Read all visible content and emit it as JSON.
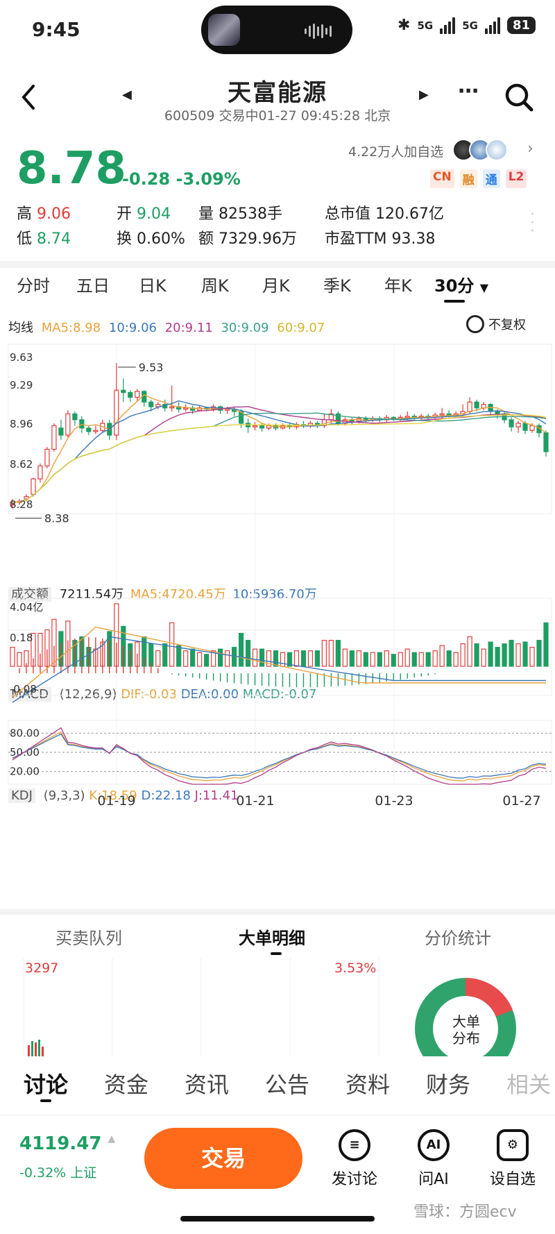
{
  "status": {
    "time": "9:45",
    "net1": "5G",
    "net2": "5G",
    "battery": "81"
  },
  "header": {
    "title": "天富能源",
    "subtitle": "600509 交易中01-27 09:45:28 北京"
  },
  "quote": {
    "price": "8.78",
    "change": "-0.28",
    "change_pct": "-3.09%",
    "watchers": "4.22万人加自选",
    "badges": [
      "CN",
      "融",
      "通",
      "L2"
    ],
    "stats": [
      {
        "label": "高",
        "value": "9.06",
        "color": "#e03b3b"
      },
      {
        "label": "开",
        "value": "9.04",
        "color": "#1e9e63"
      },
      {
        "label": "量",
        "value": "82538手",
        "color": "#222"
      },
      {
        "label": "总市值",
        "value": "120.67亿",
        "color": "#222"
      },
      {
        "label": "低",
        "value": "8.74",
        "color": "#1e9e63"
      },
      {
        "label": "换",
        "value": "0.60%",
        "color": "#222"
      },
      {
        "label": "额",
        "value": "7329.96万",
        "color": "#222"
      },
      {
        "label": "市盈TTM",
        "value": "93.38",
        "color": "#222"
      }
    ]
  },
  "period_tabs": [
    "分时",
    "五日",
    "日K",
    "周K",
    "月K",
    "季K",
    "年K",
    "30分"
  ],
  "active_period": "30分",
  "ma_legend": {
    "label": "均线",
    "ma5": "MA5:8.98",
    "ma10": "10:9.06",
    "ma20": "20:9.11",
    "ma30": "30:9.09",
    "ma60": "60:9.07",
    "adjust": "不复权"
  },
  "volume_legend": {
    "label": "成交额",
    "value": "7211.54万",
    "ma5": "MA5:4720.45万",
    "ma10": "10:5936.70万"
  },
  "macd_legend": {
    "label": "MACD",
    "params": "(12,26,9)",
    "dif": "DIF:-0.03",
    "dea": "DEA:0.00",
    "macd": "MACD:-0.07"
  },
  "kdj_legend": {
    "label": "KDJ",
    "params": "(9,3,3)",
    "k": "K:18.59",
    "d": "D:22.18",
    "j": "J:11.41"
  },
  "chart_data": {
    "type": "candlestick",
    "interval": "30分",
    "price_axis_ticks": [
      "9.63",
      "9.29",
      "8.96",
      "8.62",
      "8.28"
    ],
    "high_label": "9.53",
    "low_label": "8.38",
    "volume_axis_ticks": [
      "4.04亿"
    ],
    "macd_axis_ticks": [
      "0.18",
      "-0.08"
    ],
    "kdj_axis_ticks": [
      "80.00",
      "50.00",
      "20.00"
    ],
    "date_labels": [
      "01-19",
      "01-21",
      "01-23",
      "01-27"
    ],
    "ylim": [
      8.28,
      9.63
    ],
    "candles": [
      [
        8.33,
        8.35,
        8.3,
        8.38
      ],
      [
        8.35,
        8.36,
        8.33,
        8.38
      ],
      [
        8.38,
        8.4,
        8.36,
        8.42
      ],
      [
        8.42,
        8.55,
        8.4,
        8.56
      ],
      [
        8.55,
        8.66,
        8.52,
        8.68
      ],
      [
        8.66,
        8.8,
        8.64,
        8.82
      ],
      [
        8.8,
        9.0,
        8.78,
        9.02
      ],
      [
        8.98,
        8.92,
        8.88,
        9.05
      ],
      [
        8.92,
        9.1,
        8.9,
        9.13
      ],
      [
        9.1,
        9.05,
        9.0,
        9.12
      ],
      [
        9.05,
        8.98,
        8.94,
        9.08
      ],
      [
        8.98,
        8.95,
        8.92,
        9.0
      ],
      [
        8.95,
        8.96,
        8.93,
        9.0
      ],
      [
        8.96,
        9.02,
        8.94,
        9.05
      ],
      [
        9.02,
        8.92,
        8.88,
        9.05
      ],
      [
        8.92,
        9.3,
        8.88,
        9.53
      ],
      [
        9.3,
        9.28,
        9.2,
        9.4
      ],
      [
        9.28,
        9.24,
        9.2,
        9.3
      ],
      [
        9.24,
        9.29,
        9.2,
        9.31
      ],
      [
        9.29,
        9.2,
        9.16,
        9.3
      ],
      [
        9.2,
        9.16,
        9.12,
        9.22
      ],
      [
        9.16,
        9.18,
        9.14,
        9.2
      ],
      [
        9.18,
        9.15,
        9.12,
        9.22
      ],
      [
        9.15,
        9.16,
        9.12,
        9.34
      ],
      [
        9.16,
        9.14,
        9.11,
        9.2
      ],
      [
        9.14,
        9.15,
        9.12,
        9.18
      ],
      [
        9.15,
        9.13,
        9.1,
        9.17
      ],
      [
        9.13,
        9.15,
        9.12,
        9.17
      ],
      [
        9.15,
        9.14,
        9.12,
        9.16
      ],
      [
        9.14,
        9.16,
        9.12,
        9.18
      ],
      [
        9.16,
        9.13,
        9.1,
        9.17
      ],
      [
        9.13,
        9.14,
        9.1,
        9.16
      ],
      [
        9.14,
        9.12,
        9.08,
        9.16
      ],
      [
        9.12,
        9.02,
        8.98,
        9.14
      ],
      [
        9.02,
        8.99,
        8.94,
        9.06
      ],
      [
        8.99,
        9.0,
        8.96,
        9.03
      ],
      [
        9.0,
        8.98,
        8.95,
        9.02
      ],
      [
        8.98,
        9.0,
        8.96,
        9.02
      ],
      [
        9.0,
        8.98,
        8.96,
        9.02
      ],
      [
        8.98,
        9.0,
        8.97,
        9.02
      ],
      [
        9.0,
        8.99,
        8.97,
        9.02
      ],
      [
        8.99,
        9.01,
        8.97,
        9.03
      ],
      [
        9.01,
        9.0,
        8.98,
        9.04
      ],
      [
        9.0,
        9.02,
        8.98,
        9.04
      ],
      [
        9.02,
        9.0,
        8.98,
        9.04
      ],
      [
        9.0,
        9.05,
        8.98,
        9.1
      ],
      [
        9.05,
        9.1,
        9.02,
        9.14
      ],
      [
        9.1,
        9.02,
        9.0,
        9.12
      ],
      [
        9.02,
        9.05,
        9.0,
        9.07
      ],
      [
        9.05,
        9.04,
        9.01,
        9.07
      ],
      [
        9.04,
        9.06,
        9.02,
        9.08
      ],
      [
        9.06,
        9.05,
        9.03,
        9.08
      ],
      [
        9.05,
        9.06,
        9.03,
        9.08
      ],
      [
        9.06,
        9.05,
        9.03,
        9.08
      ],
      [
        9.05,
        9.07,
        9.03,
        9.09
      ],
      [
        9.07,
        9.06,
        9.04,
        9.08
      ],
      [
        9.06,
        9.07,
        9.04,
        9.09
      ],
      [
        9.07,
        9.08,
        9.05,
        9.12
      ],
      [
        9.08,
        9.07,
        9.05,
        9.1
      ],
      [
        9.07,
        9.08,
        9.05,
        9.1
      ],
      [
        9.08,
        9.07,
        9.05,
        9.1
      ],
      [
        9.07,
        9.09,
        9.05,
        9.11
      ],
      [
        9.09,
        9.1,
        9.06,
        9.15
      ],
      [
        9.1,
        9.09,
        9.07,
        9.13
      ],
      [
        9.09,
        9.1,
        9.07,
        9.12
      ],
      [
        9.1,
        9.12,
        9.08,
        9.18
      ],
      [
        9.12,
        9.2,
        9.1,
        9.24
      ],
      [
        9.2,
        9.15,
        9.12,
        9.22
      ],
      [
        9.15,
        9.18,
        9.13,
        9.2
      ],
      [
        9.18,
        9.12,
        9.08,
        9.19
      ],
      [
        9.12,
        9.1,
        9.06,
        9.14
      ],
      [
        9.1,
        9.05,
        9.02,
        9.12
      ],
      [
        9.05,
        8.99,
        8.95,
        9.07
      ],
      [
        8.99,
        9.02,
        8.94,
        9.04
      ],
      [
        9.02,
        8.96,
        8.93,
        9.04
      ],
      [
        8.96,
        9.0,
        8.94,
        9.02
      ],
      [
        9.0,
        8.94,
        8.9,
        9.02
      ],
      [
        8.94,
        8.78,
        8.74,
        8.96
      ]
    ]
  },
  "section_tabs": [
    "买卖队列",
    "大单明细",
    "分价统计"
  ],
  "active_section_tab": "大单明细",
  "detail": {
    "left_value": "3297",
    "right_value": "3.53%",
    "donut_label": "大单分布"
  },
  "bottom_nav": [
    "讨论",
    "资金",
    "资讯",
    "公告",
    "资料",
    "财务",
    "相关"
  ],
  "active_nav": "讨论",
  "index": {
    "value": "4119.47",
    "change": "-0.32% 上证"
  },
  "actions": {
    "trade": "交易",
    "discuss": "发讨论",
    "ai_icon": "AI",
    "ask_ai": "问AI",
    "watchlist": "设自选"
  },
  "watermark": "雪球：方圆ecv",
  "colors": {
    "up": "#e03b3b",
    "down": "#1e9e63",
    "ma5": "#e8a23b",
    "ma10": "#3b78b8",
    "ma20": "#b03b8a",
    "ma30": "#3b9e8a",
    "ma60": "#e8d43b",
    "accent": "#ff6a1a"
  }
}
